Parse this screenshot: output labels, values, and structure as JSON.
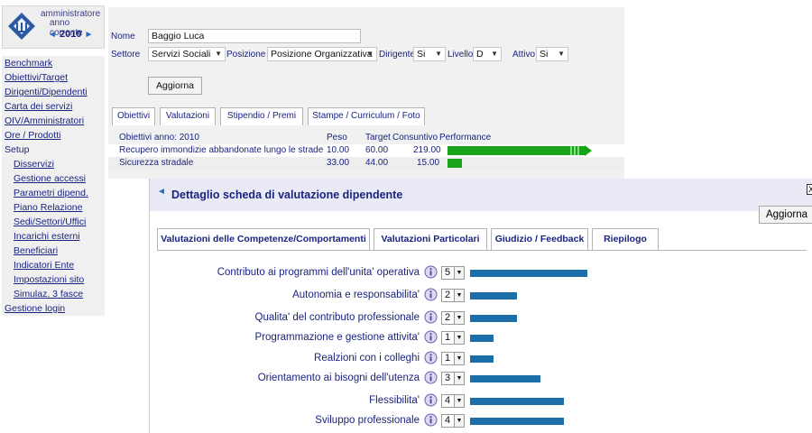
{
  "sidebar": {
    "logo": {
      "line1": "amministratore",
      "line2": "anno corrente",
      "year": "2010",
      "prev_arrow": "◄",
      "next_arrow": "►"
    },
    "items": [
      {
        "label": "Benchmark",
        "sub": false,
        "link": true
      },
      {
        "label": "Obiettivi/Target",
        "sub": false,
        "link": true
      },
      {
        "label": "Dirigenti/Dipendenti",
        "sub": false,
        "link": true
      },
      {
        "label": "Carta dei servizi",
        "sub": false,
        "link": true
      },
      {
        "label": "OIV/Amministratori",
        "sub": false,
        "link": true
      },
      {
        "label": "Ore / Prodotti",
        "sub": false,
        "link": true
      },
      {
        "label": "Setup",
        "sub": false,
        "link": false
      },
      {
        "label": "Disservizi",
        "sub": true,
        "link": true
      },
      {
        "label": "Gestione accessi",
        "sub": true,
        "link": true
      },
      {
        "label": "Parametri dipend.",
        "sub": true,
        "link": true
      },
      {
        "label": "Piano Relazione",
        "sub": true,
        "link": true
      },
      {
        "label": "Sedi/Settori/Uffici",
        "sub": true,
        "link": true
      },
      {
        "label": "Incarichi esterni",
        "sub": true,
        "link": true
      },
      {
        "label": "Beneficiari",
        "sub": true,
        "link": true
      },
      {
        "label": "Indicatori Ente",
        "sub": true,
        "link": true
      },
      {
        "label": "Impostazioni sito",
        "sub": true,
        "link": true
      },
      {
        "label": "Simulaz. 3 fasce",
        "sub": true,
        "link": true
      },
      {
        "label": "Gestione login",
        "sub": false,
        "link": true
      }
    ]
  },
  "form": {
    "nome_label": "Nome",
    "nome_value": "Baggio Luca",
    "settore_label": "Settore",
    "settore_value": "Servizi Sociali",
    "posizione_label": "Posizione",
    "posizione_value": "Posizione Organizzativa",
    "dirigente_label": "Dirigente",
    "dirigente_value": "Si",
    "livello_label": "Livello",
    "livello_value": "D",
    "attivo_label": "Attivo",
    "attivo_value": "Si",
    "update_button": "Aggiorna"
  },
  "main_tabs": [
    "Obiettivi",
    "Valutazioni",
    "Stipendio / Premi",
    "Stampe / Curriculum / Foto"
  ],
  "objectives": {
    "header": {
      "title": "Obiettivi anno: 2010",
      "peso": "Peso",
      "target": "Target",
      "consuntivo": "Consuntivo",
      "performance": "Performance"
    },
    "rows": [
      {
        "name": "Recupero immondizie abbandonate lungo le strade",
        "peso": "10.00",
        "target": "60.00",
        "consuntivo": "219.00",
        "performance_ratio": 3.65,
        "overflow": true
      },
      {
        "name": "Sicurezza stradale",
        "peso": "33.00",
        "target": "44.00",
        "consuntivo": "15.00",
        "performance_ratio": 0.34,
        "overflow": false
      }
    ]
  },
  "modal": {
    "title": "Dettaglio scheda di valutazione dipendente",
    "close_label": "X",
    "update_button": "Aggiorna",
    "tabs": [
      "Valutazioni delle Competenze/Comportamenti",
      "Valutazioni Particolari",
      "Giudizio / Feedback",
      "Riepilogo"
    ],
    "active_tab": 0,
    "scale_max": 5,
    "bar_color": "#1b6fa8",
    "competencies": [
      {
        "label": "Contributo ai programmi dell'unita' operativa",
        "score": "5"
      },
      {
        "label": "Autonomia e responsabilita'",
        "score": "2"
      },
      {
        "label": "Qualita' del contributo professionale",
        "score": "2"
      },
      {
        "label": "Programmazione e gestione attivita'",
        "score": "1"
      },
      {
        "label": "Realzioni con i colleghi",
        "score": "1"
      },
      {
        "label": "Orientamento ai bisogni dell'utenza",
        "score": "3"
      },
      {
        "label": "Flessibilita'",
        "score": "4"
      },
      {
        "label": "Sviluppo professionale",
        "score": "4"
      }
    ]
  },
  "colors": {
    "accent": "#1a237e",
    "green_bar": "#19a319",
    "blue_bar": "#1b6fa8",
    "panel_bg": "#f1f1f1",
    "modal_header_bg": "#eaeaf7"
  },
  "icons": {
    "logo": "building-emblem-icon",
    "info": "info-icon",
    "dropdown": "chevron-down-icon",
    "title_arrow": "arrow-left-icon"
  }
}
